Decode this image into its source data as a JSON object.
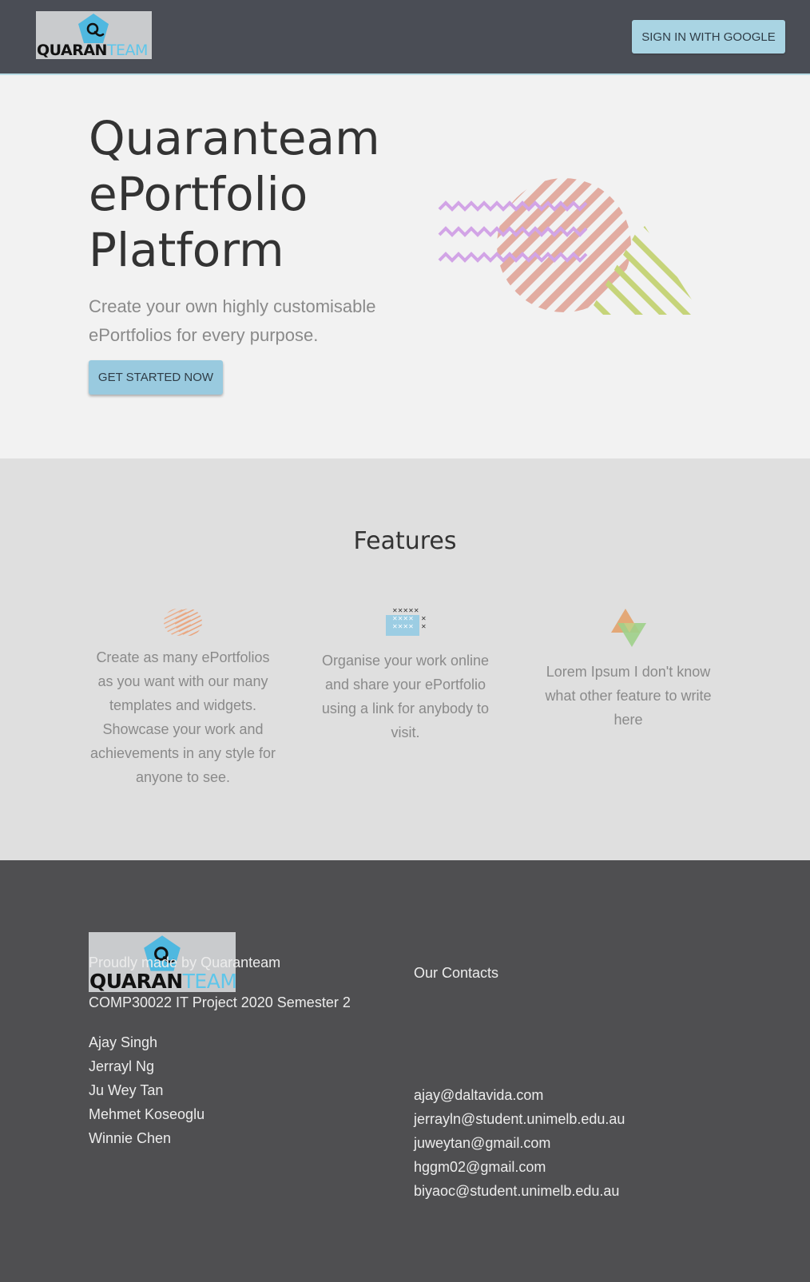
{
  "nav": {
    "logo": {
      "word_dark": "QUARAN",
      "word_light": "TEAM"
    },
    "signin_label": "SIGN IN WITH GOOGLE"
  },
  "hero": {
    "title_lines": [
      "Quaranteam",
      "ePortfolio",
      "Platform"
    ],
    "subtitle": "Create your own highly customisable ePortfolios for every purpose.",
    "cta_label": "GET STARTED NOW"
  },
  "features": {
    "title": "Features",
    "items": [
      {
        "icon": "hatched-circles-icon",
        "text": "Create as many ePortfolios as you want with our many templates and widgets. Showcase your work and achievements in any style for anyone to see."
      },
      {
        "icon": "grid-pattern-icon",
        "text": "Organise your work online and share your ePortfolio using a link for anybody to visit."
      },
      {
        "icon": "triangles-icon",
        "text": "Lorem Ipsum I don't know what other feature to write here"
      }
    ]
  },
  "footer": {
    "logo": {
      "word_dark": "QUARAN",
      "word_light": "TEAM"
    },
    "made_by": "Proudly made by Quaranteam",
    "course": "COMP30022 IT Project 2020 Semester 2",
    "members": [
      "Ajay Singh",
      "Jerrayl Ng",
      "Ju Wey Tan",
      "Mehmet Koseoglu",
      "Winnie Chen"
    ],
    "contacts_title": "Our Contacts",
    "emails": [
      "ajay@daltavida.com",
      "jerrayln@student.unimelb.edu.au",
      "juweytan@gmail.com",
      "hggm02@gmail.com",
      "biyaoc@student.unimelb.edu.au"
    ]
  },
  "colors": {
    "nav_bg": "#4a4d55",
    "accent_blue": "#99cadf",
    "footer_bg": "#4f4f51",
    "features_bg": "#dfdfdf",
    "hero_bg": "#f2f2f2"
  }
}
